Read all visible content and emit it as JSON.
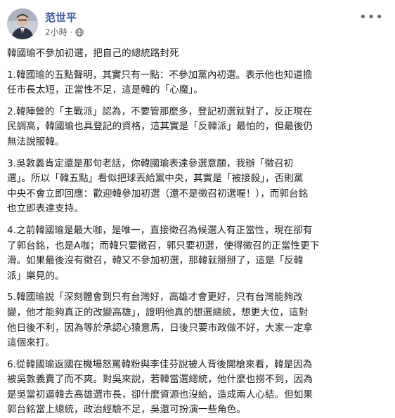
{
  "author": {
    "name": "范世平"
  },
  "post_meta": {
    "time": "2小時",
    "separator": "·",
    "privacy_icon": "globe-icon"
  },
  "menu_icon": "more-options-icon",
  "post": {
    "title": "韓國瑜不參加初選，把自己的總統路封死",
    "paragraphs": [
      [
        "1.韓國瑜的五點聲明，其實只有一點：不參加黨內初選。表示他也知道擔",
        "任市長太短，正當性不足，這是韓的「心魔」。"
      ],
      [
        "2.韓陣營的「主戰派」認為，不要管那麼多，登記初選就對了，反正現在",
        "民調高，韓國瑜也具登記的資格，這其實是「反韓派」最怕的，但最後仍",
        "無法說服韓。"
      ],
      [
        "3.吳敦義肯定還是那句老話，你韓國瑜表達參選意願，我辦「徵召初",
        "選」。所以「韓五點」看似把球丟給黨中央，其實是「被接殺」，否則黨",
        "中央不會立即回應：歡迎韓參加初選（還不是徵召初選喔！），而郭台銘",
        "也立即表達支持。"
      ],
      [
        "4.之前韓國瑜是最大咖，是唯一，直接徵召為候選人有正當性，現在卻有",
        "了郭台銘，也是A咖；而韓只要徵召，郭只要初選，使得徵召的正當性更下",
        "滑。如果最後沒有徵召，韓又不參加初選，那韓就掰掰了，這是「反韓",
        "派」樂見的。"
      ],
      [
        "5.韓國瑜說「深刻體會到只有台灣好，高雄才會更好，只有台灣能夠改",
        "變，他才能夠真正的改變高雄」，證明他真的想選總統，想更大位，這對",
        "他日後不利，因為等於承認心猿意馬，日後只要市政做不好，大家一定拿",
        "這個來打。"
      ],
      [
        "6.從韓國瑜返國在機場怒罵韓粉與李佳芬說被人背後開槍來看，韓是因為",
        "被吳敦義賣了而不爽。對吳來說，若韓當選總統，他什麼也撈不到，因為",
        "是吳當初逼韓去高雄選市長，卻什麼資源也沒給，造成兩人心結。但如果",
        "郭台銘當上總統，政治經驗不足，吳還可扮演一些角色。"
      ]
    ]
  }
}
